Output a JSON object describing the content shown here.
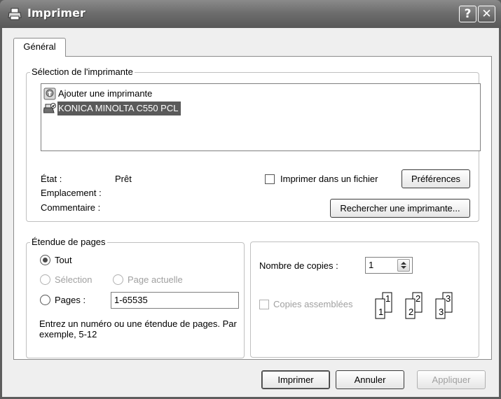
{
  "window": {
    "title": "Imprimer",
    "help_button": "?",
    "close_button": "✕"
  },
  "tabs": [
    {
      "label": "Général",
      "selected": true
    }
  ],
  "printer_selection": {
    "group_title": "Sélection de l'imprimante",
    "printers": [
      {
        "name": "Ajouter une imprimante",
        "icon": "add-printer-icon",
        "selected": false
      },
      {
        "name": "KONICA MINOLTA C550 PCL",
        "icon": "default-printer-icon",
        "selected": true
      }
    ],
    "status_label": "État :",
    "status_value": "Prêt",
    "location_label": "Emplacement :",
    "location_value": "",
    "comment_label": "Commentaire :",
    "comment_value": "",
    "print_to_file_label": "Imprimer dans un fichier",
    "print_to_file_checked": false,
    "preferences_button": "Préférences",
    "find_printer_button": "Rechercher une imprimante..."
  },
  "page_range": {
    "group_title": "Étendue de pages",
    "all_label": "Tout",
    "all_checked": true,
    "selection_label": "Sélection",
    "current_page_label": "Page actuelle",
    "pages_label": "Pages :",
    "pages_value": "1-65535",
    "hint": "Entrez un numéro ou une étendue de pages. Par exemple, 5-12"
  },
  "copies": {
    "count_label": "Nombre de copies :",
    "count_value": "1",
    "collate_label": "Copies assemblées",
    "collate_checked": false
  },
  "buttons": {
    "print": "Imprimer",
    "cancel": "Annuler",
    "apply": "Appliquer"
  }
}
